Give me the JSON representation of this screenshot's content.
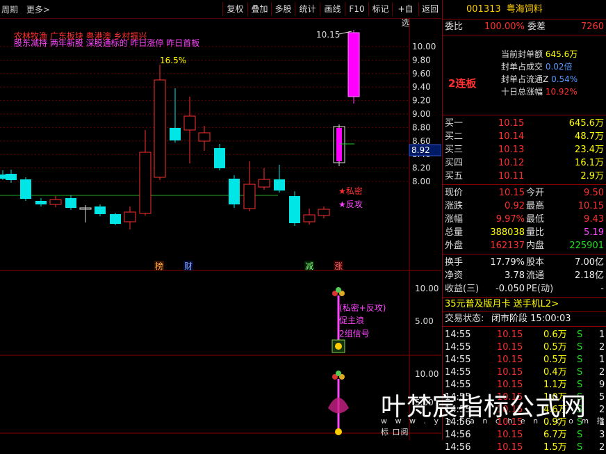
{
  "toolbar": {
    "period": "周期",
    "more": "更多>",
    "buttons": [
      "复权",
      "叠加",
      "多股",
      "统计",
      "画线",
      "F10",
      "标记",
      "+自选",
      "返回"
    ]
  },
  "chart": {
    "concepts_line1": "农林牧渔  广东板块  粤港澳 乡村振兴",
    "concepts_line2": "股东减持 两年新股 深股通标的 昨日涨停 昨日首板",
    "max_label": "10.15",
    "pct_label": "16.5%",
    "price_ticks": [
      "10.00",
      "9.80",
      "9.60",
      "9.40",
      "9.20",
      "9.00",
      "8.80",
      "8.60",
      "8.40",
      "8.20",
      "8.00"
    ],
    "current_price_tag": "8.92",
    "signal1": "★私密",
    "signal2": "★反攻",
    "markers": [
      "榜",
      "财",
      "减",
      "涨"
    ],
    "sub1_ticks": [
      "10.00",
      "5.00"
    ],
    "sub1_text1": "(私密+反攻)",
    "sub1_text2": "促主浪",
    "sub1_text3": "2组信号",
    "sub2_ticks": [
      "10.00",
      "5.00"
    ]
  },
  "panel": {
    "code": "001313",
    "name": "粤海饲料",
    "weibi_label": "委比",
    "weibi_value": "100.00%",
    "weicha_label": "委差",
    "weicha_value": "7260",
    "streak": "2连板",
    "seal_amount_label": "当前封单额",
    "seal_amount_value": "645.6万",
    "seal_vol_label": "封单占成交",
    "seal_vol_value": "0.02倍",
    "seal_float_label": "封单占流通Z",
    "seal_float_value": "0.54%",
    "ten_day_label": "十日总涨幅",
    "ten_day_value": "10.92%",
    "bids": [
      {
        "label": "买一",
        "price": "10.15",
        "vol": "645.6万"
      },
      {
        "label": "买二",
        "price": "10.14",
        "vol": "48.7万"
      },
      {
        "label": "买三",
        "price": "10.13",
        "vol": "23.4万"
      },
      {
        "label": "买四",
        "price": "10.12",
        "vol": "16.1万"
      },
      {
        "label": "买五",
        "price": "10.11",
        "vol": "2.9万"
      }
    ],
    "stats": [
      {
        "l1": "现价",
        "v1": "10.15",
        "l2": "今开",
        "v2": "9.50",
        "c1": "red",
        "c2": "red"
      },
      {
        "l1": "涨跌",
        "v1": "0.92",
        "l2": "最高",
        "v2": "10.15",
        "c1": "red",
        "c2": "red"
      },
      {
        "l1": "涨幅",
        "v1": "9.97%",
        "l2": "最低",
        "v2": "9.43",
        "c1": "red",
        "c2": "red"
      },
      {
        "l1": "总量",
        "v1": "388038",
        "l2": "量比",
        "v2": "5.19",
        "c1": "yellow",
        "c2": "magenta"
      },
      {
        "l1": "外盘",
        "v1": "162137",
        "l2": "内盘",
        "v2": "225901",
        "c1": "red",
        "c2": "green"
      }
    ],
    "stats2": [
      {
        "l1": "换手",
        "v1": "17.79%",
        "l2": "股本",
        "v2": "7.00亿"
      },
      {
        "l1": "净资",
        "v1": "3.78",
        "l2": "流通",
        "v2": "2.18亿"
      },
      {
        "l1": "收益(三)",
        "v1": "-0.050",
        "l2": "PE(动)",
        "v2": "-"
      }
    ],
    "promo": "35元普及版月卡 送手机L2>",
    "trade_status_label": "交易状态:",
    "trade_status_value": "闭市阶段 15:00:03",
    "ticks": [
      {
        "t": "14:55",
        "p": "10.15",
        "v": "0.6万",
        "s": "S",
        "n": "1"
      },
      {
        "t": "14:55",
        "p": "10.15",
        "v": "0.5万",
        "s": "S",
        "n": "2"
      },
      {
        "t": "14:55",
        "p": "10.15",
        "v": "0.5万",
        "s": "S",
        "n": "1"
      },
      {
        "t": "14:55",
        "p": "10.15",
        "v": "0.4万",
        "s": "S",
        "n": "2"
      },
      {
        "t": "14:55",
        "p": "10.15",
        "v": "1.1万",
        "s": "S",
        "n": "9"
      },
      {
        "t": "14:55",
        "p": "10.15",
        "v": "1.0万",
        "s": "S",
        "n": "5"
      },
      {
        "t": "14:55",
        "p": "10.15",
        "v": "4.6万",
        "s": "S",
        "n": "2"
      },
      {
        "t": "14:56",
        "p": "10.15",
        "v": "0.9万",
        "s": "S",
        "n": "1"
      },
      {
        "t": "14:56",
        "p": "10.15",
        "v": "6.7万",
        "s": "S",
        "n": "3"
      },
      {
        "t": "14:56",
        "p": "10.15",
        "v": "1.5万",
        "s": "S",
        "n": "2"
      }
    ]
  },
  "watermark": {
    "main": "叶梵宸指标公式网",
    "sub": "w w w . y e f a n c h e n . c o m",
    "sub2": "指标 口阅"
  }
}
